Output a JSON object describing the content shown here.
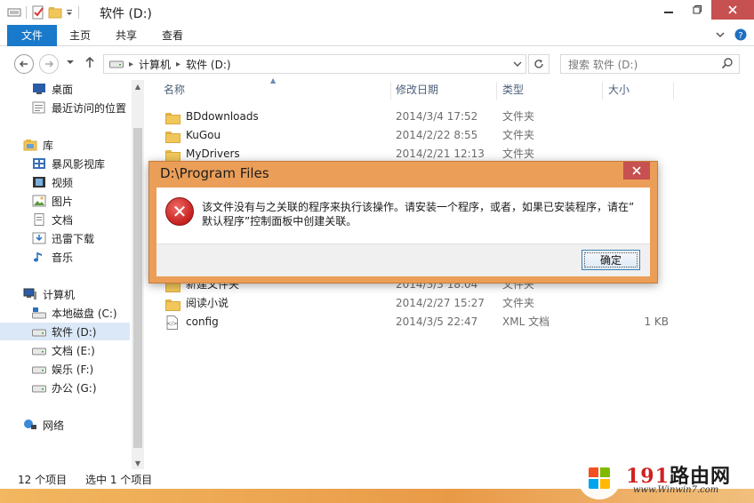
{
  "window": {
    "title": "软件 (D:)"
  },
  "ribbon": {
    "tabs": [
      "文件",
      "主页",
      "共享",
      "查看"
    ],
    "expand_icon": "chevron-down-icon",
    "help_icon": "help-icon"
  },
  "address": {
    "crumbs": [
      "计算机",
      "软件 (D:)"
    ],
    "search_placeholder": "搜索 软件 (D:)"
  },
  "sidebar": {
    "favorites": [
      {
        "label": "桌面",
        "icon": "desktop-icon"
      },
      {
        "label": "最近访问的位置",
        "icon": "recent-places-icon"
      }
    ],
    "libraries_label": "库",
    "libraries": [
      {
        "label": "暴风影视库",
        "icon": "video-library-icon"
      },
      {
        "label": "视频",
        "icon": "video-icon"
      },
      {
        "label": "图片",
        "icon": "picture-icon"
      },
      {
        "label": "文档",
        "icon": "document-icon"
      },
      {
        "label": "迅雷下载",
        "icon": "download-icon"
      },
      {
        "label": "音乐",
        "icon": "music-icon"
      }
    ],
    "computer_label": "计算机",
    "drives": [
      {
        "label": "本地磁盘 (C:)",
        "icon": "system-drive-icon"
      },
      {
        "label": "软件 (D:)",
        "icon": "drive-icon",
        "selected": true
      },
      {
        "label": "文档 (E:)",
        "icon": "drive-icon"
      },
      {
        "label": "娱乐 (F:)",
        "icon": "drive-icon"
      },
      {
        "label": "办公 (G:)",
        "icon": "drive-icon"
      }
    ],
    "network_label": "网络"
  },
  "filelist": {
    "columns": {
      "name": "名称",
      "date": "修改日期",
      "type": "类型",
      "size": "大小"
    },
    "rows": [
      {
        "name": "BDdownloads",
        "date": "2014/3/4 17:52",
        "type": "文件夹",
        "size": ""
      },
      {
        "name": "KuGou",
        "date": "2014/2/22 8:55",
        "type": "文件夹",
        "size": ""
      },
      {
        "name": "MyDrivers",
        "date": "2014/2/21 12:13",
        "type": "文件夹",
        "size": ""
      },
      {
        "name": "新建文件夹",
        "date": "2014/3/3 18:04",
        "type": "文件夹",
        "size": ""
      },
      {
        "name": "阅读小说",
        "date": "2014/2/27 15:27",
        "type": "文件夹",
        "size": ""
      },
      {
        "name": "config",
        "date": "2014/3/5 22:47",
        "type": "XML 文档",
        "size": "1 KB"
      }
    ]
  },
  "status": {
    "count": "12 个项目",
    "selected": "选中 1 个项目"
  },
  "dialog": {
    "title": "D:\\Program Files",
    "message_line1": "该文件没有与之关联的程序来执行该操作。请安装一个程序，或者，如果已安装程序，请在”",
    "message_line2": "默认程序”控制面板中创建关联。",
    "ok_label": "确定",
    "icon": "error-icon"
  },
  "watermark": {
    "main_digits": "191",
    "main_text": "路由网",
    "url": "www.Winwin7.com"
  },
  "colors": {
    "accent": "#1979ca",
    "dialog_frame": "#eb9e58",
    "close_red": "#c75050",
    "selection": "#dbe8f7"
  }
}
